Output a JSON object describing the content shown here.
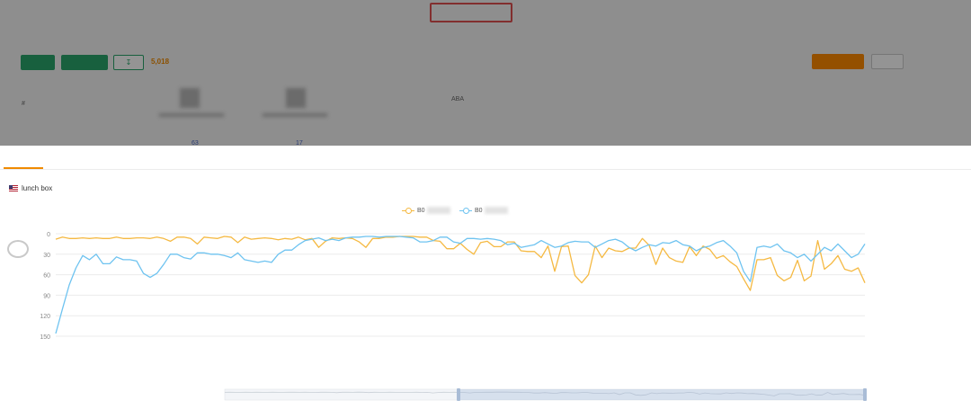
{
  "top_tabs": [
    {
      "label": "",
      "selected": false
    },
    {
      "label": "",
      "selected": false
    },
    {
      "label": "",
      "selected": false
    },
    {
      "label": "",
      "selected": true
    },
    {
      "label": "",
      "selected": false
    },
    {
      "label": "",
      "selected": false
    },
    {
      "label": "",
      "selected": false
    }
  ],
  "toolbar": {
    "btn1": "",
    "btn2": "",
    "export": "",
    "result_label": "",
    "result_count": "5,018",
    "btn_orange": "",
    "btn_white": ""
  },
  "table_headers": [
    "#",
    "",
    "",
    "",
    "ABA",
    "",
    "",
    "",
    "",
    "",
    "",
    ""
  ],
  "table_values": [
    "63",
    "17"
  ],
  "modal": {
    "tabs": [
      {
        "label": "",
        "selected": true
      },
      {
        "label": "",
        "selected": false
      }
    ],
    "keyword_label": "",
    "keyword": "lunch box",
    "legend": [
      {
        "name": "B0",
        "color": "#f5b942"
      },
      {
        "name": "B0",
        "color": "#6ec3f0"
      }
    ],
    "footer_note": ""
  },
  "watermark": "",
  "colors": {
    "accent_orange": "#f08a00",
    "green": "#2aa66b",
    "series_orange": "#f5b942",
    "series_blue": "#6ec3f0",
    "highlight_red": "#e05050"
  },
  "chart_data": {
    "type": "line",
    "ylim": [
      0,
      150
    ],
    "y_ticks": [
      0,
      30,
      60,
      90,
      120,
      150
    ],
    "y_reversed": true,
    "grid": true,
    "x_label_step": 2,
    "x": [],
    "series": [
      {
        "name": "",
        "color": "#f5b942",
        "values": [
          8,
          5,
          7,
          7,
          6,
          7,
          6,
          7,
          7,
          5,
          7,
          7,
          6,
          6,
          7,
          5,
          7,
          11,
          5,
          5,
          7,
          15,
          5,
          6,
          7,
          4,
          5,
          13,
          5,
          8,
          7,
          6,
          7,
          9,
          7,
          8,
          5,
          9,
          7,
          20,
          11,
          6,
          7,
          6,
          7,
          12,
          20,
          7,
          7,
          5,
          5,
          4,
          4,
          4,
          5,
          5,
          10,
          11,
          22,
          22,
          14,
          23,
          30,
          13,
          11,
          19,
          19,
          12,
          12,
          25,
          26,
          26,
          35,
          18,
          55,
          19,
          18,
          61,
          72,
          60,
          18,
          35,
          21,
          25,
          26,
          21,
          21,
          7,
          17,
          45,
          21,
          35,
          40,
          42,
          19,
          32,
          18,
          23,
          36,
          32,
          41,
          48,
          66,
          83,
          38,
          38,
          35,
          61,
          69,
          64,
          39,
          69,
          62,
          10,
          52,
          44,
          32,
          52,
          55,
          50,
          72
        ]
      },
      {
        "name": "",
        "color": "#6ec3f0",
        "values": [
          146,
          110,
          75,
          50,
          32,
          38,
          30,
          44,
          44,
          34,
          38,
          38,
          40,
          58,
          64,
          58,
          45,
          30,
          30,
          35,
          37,
          28,
          28,
          30,
          30,
          32,
          35,
          28,
          38,
          40,
          42,
          40,
          42,
          30,
          24,
          24,
          16,
          10,
          8,
          6,
          10,
          8,
          10,
          6,
          5,
          5,
          4,
          4,
          5,
          4,
          4,
          4,
          5,
          6,
          12,
          12,
          10,
          5,
          5,
          12,
          14,
          7,
          7,
          8,
          7,
          8,
          10,
          16,
          14,
          20,
          18,
          16,
          10,
          15,
          20,
          18,
          13,
          11,
          12,
          12,
          20,
          15,
          10,
          8,
          12,
          20,
          25,
          20,
          16,
          18,
          13,
          14,
          10,
          16,
          18,
          25,
          20,
          18,
          13,
          10,
          18,
          28,
          55,
          70,
          20,
          18,
          20,
          15,
          25,
          28,
          35,
          30,
          40,
          30,
          20,
          25,
          15,
          25,
          35,
          30,
          15
        ]
      }
    ]
  }
}
